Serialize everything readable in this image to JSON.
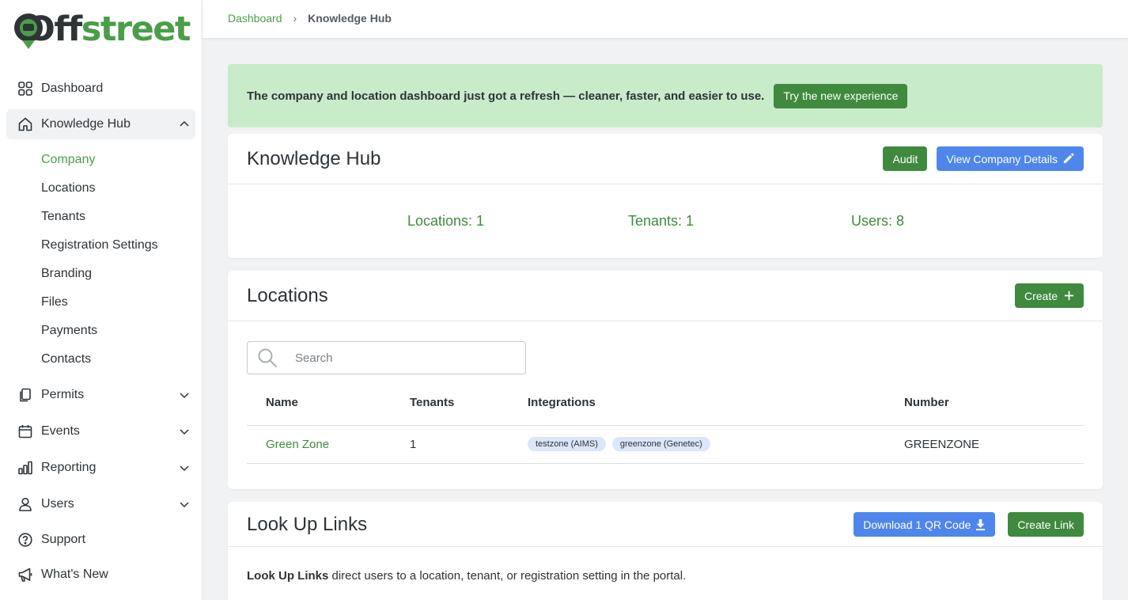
{
  "brand": {
    "logo_dark": "Off",
    "logo_green": "street"
  },
  "colors": {
    "green": "#3f8a3e",
    "blue": "#4f86ec",
    "banner_bg": "#c8ebca"
  },
  "breadcrumb": {
    "home": "Dashboard",
    "separator": "›",
    "current": "Knowledge Hub"
  },
  "sidebar": {
    "items": [
      {
        "label": "Dashboard",
        "icon": "grid-icon"
      },
      {
        "label": "Knowledge Hub",
        "icon": "home-icon",
        "expanded": true
      },
      {
        "label": "Permits",
        "icon": "document-icon"
      },
      {
        "label": "Events",
        "icon": "calendar-icon"
      },
      {
        "label": "Reporting",
        "icon": "bar-chart-icon"
      },
      {
        "label": "Users",
        "icon": "user-icon"
      },
      {
        "label": "Support",
        "icon": "help-circle-icon"
      },
      {
        "label": "What's New",
        "icon": "megaphone-icon"
      }
    ],
    "sub_items": [
      "Company",
      "Locations",
      "Tenants",
      "Registration Settings",
      "Branding",
      "Files",
      "Payments",
      "Contacts"
    ],
    "active_sub": "Company"
  },
  "banner": {
    "text": "The company and location dashboard just got a refresh — cleaner, faster, and easier to use.",
    "button": "Try the new experience"
  },
  "knowledge_hub": {
    "title": "Knowledge Hub",
    "audit_button": "Audit",
    "details_button": "View Company Details",
    "stats": {
      "locations": "Locations: 1",
      "tenants": "Tenants: 1",
      "users": "Users: 8"
    }
  },
  "locations": {
    "title": "Locations",
    "create_button": "Create",
    "search_placeholder": "Search",
    "columns": [
      "Name",
      "Tenants",
      "Integrations",
      "Number"
    ],
    "rows": [
      {
        "name": "Green Zone",
        "tenants": "1",
        "integrations": [
          "testzone (AIMS)",
          "greenzone (Genetec)"
        ],
        "number": "GREENZONE"
      }
    ]
  },
  "lookup_links": {
    "title": "Look Up Links",
    "download_button": "Download 1 QR Code",
    "create_button": "Create Link",
    "desc_bold": "Look Up Links",
    "desc_rest": " direct users to a location, tenant, or registration setting in the portal."
  }
}
